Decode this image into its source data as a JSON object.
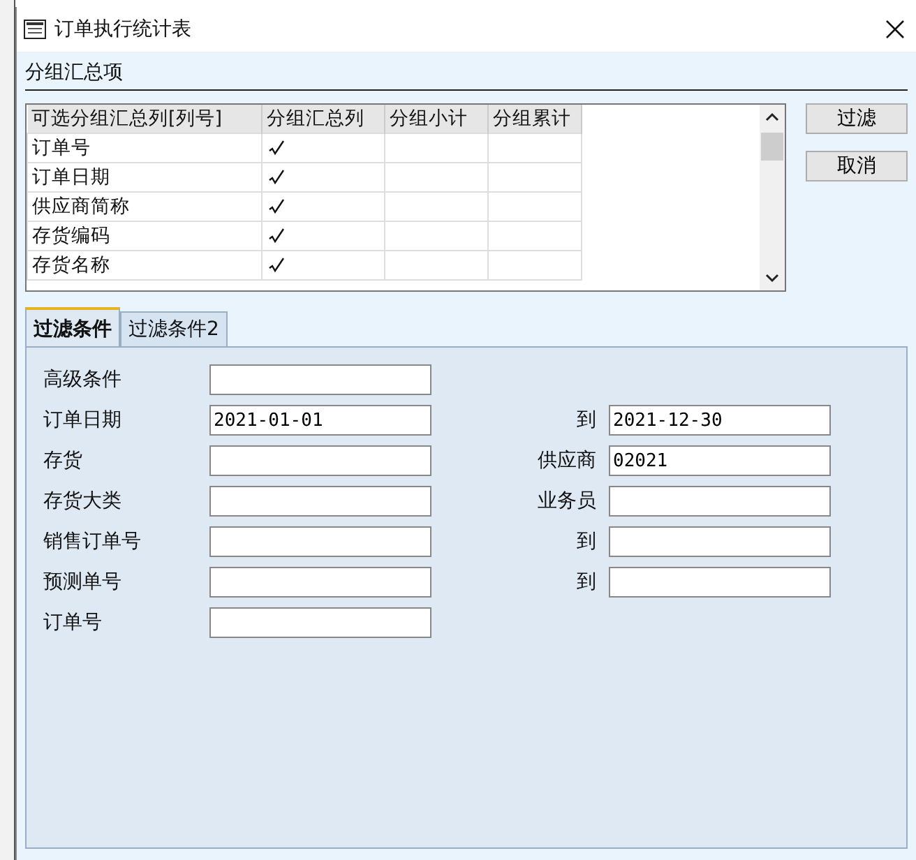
{
  "window": {
    "title": "订单执行统计表"
  },
  "group_section": {
    "title": "分组汇总项"
  },
  "group_table": {
    "columns": [
      "可选分组汇总列[列号]",
      "分组汇总列",
      "分组小计",
      "分组累计"
    ],
    "rows": [
      {
        "name": "订单号",
        "group_total": true
      },
      {
        "name": "订单日期",
        "group_total": true
      },
      {
        "name": "供应商简称",
        "group_total": true
      },
      {
        "name": "存货编码",
        "group_total": true
      },
      {
        "name": "存货名称",
        "group_total": true
      }
    ]
  },
  "buttons": [
    "过滤",
    "取消"
  ],
  "tabs": [
    {
      "label": "过滤条件",
      "selected": true
    },
    {
      "label": "过滤条件2",
      "selected": false
    }
  ],
  "form_rows": [
    {
      "label": "高级条件"
    },
    {
      "label": "订单日期",
      "value": "2021-01-01",
      "right": {
        "label": "到",
        "value": "2021-12-30"
      }
    },
    {
      "label": "存货",
      "right": {
        "label": "供应商",
        "value": "02021"
      }
    },
    {
      "label": "存货大类",
      "right": {
        "label": "业务员"
      }
    },
    {
      "label": "销售订单号",
      "right": {
        "label": "到"
      }
    },
    {
      "label": "预测单号",
      "right": {
        "label": "到"
      }
    },
    {
      "label": "订单号"
    }
  ]
}
